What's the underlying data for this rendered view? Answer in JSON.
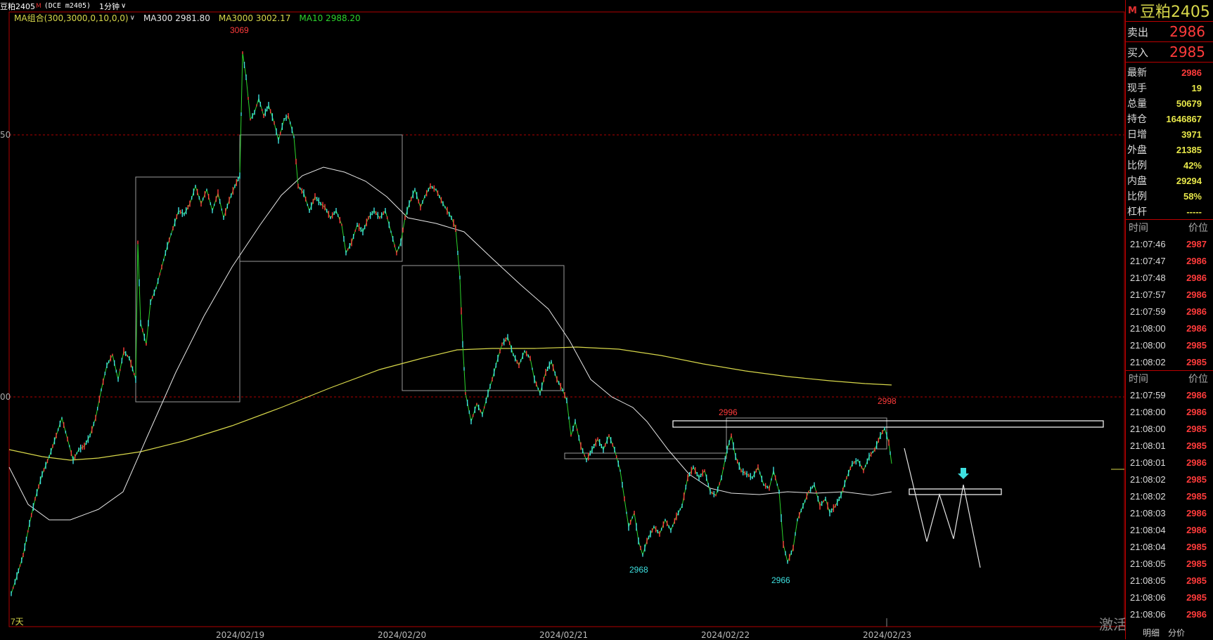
{
  "header": {
    "symbol": "豆粕2405",
    "marker": "M",
    "exchange": "(DCE m2405)",
    "interval": "1分钟"
  },
  "legend": {
    "indicator": "MA组合(300,3000,0,10,0,0)",
    "ma300": "MA300 2981.80",
    "ma3000": "MA3000 3002.17",
    "ma10": "MA10 2988.20"
  },
  "colors": {
    "up": "#ff3b3b",
    "down": "#3ee0e0",
    "ma300": "#e0e0e0",
    "ma3000": "#d8d84a",
    "ma10": "#2cd42c",
    "border": "#b00000"
  },
  "chart": {
    "period_tag": "7天",
    "left_price_marks": [
      "50",
      "00"
    ],
    "annotations": {
      "high": "3069",
      "peak1": "2996",
      "peak2": "2998",
      "low1": "2968",
      "low2": "2966"
    },
    "dates": [
      "2024/02/19",
      "2024/02/20",
      "2024/02/21",
      "2024/02/22",
      "2024/02/23"
    ]
  },
  "panel": {
    "title": "豆粕2405",
    "sell_label": "卖出",
    "sell_price": "2986",
    "buy_label": "买入",
    "buy_price": "2985",
    "stats": [
      {
        "label": "最新",
        "value": "2986"
      },
      {
        "label": "现手",
        "value": "19"
      },
      {
        "label": "总量",
        "value": "50679"
      },
      {
        "label": "持仓",
        "value": "1646867"
      },
      {
        "label": "日增",
        "value": "3971"
      },
      {
        "label": "外盘",
        "value": "21385"
      },
      {
        "label": "比例",
        "value": "42%"
      },
      {
        "label": "内盘",
        "value": "29294"
      },
      {
        "label": "比例",
        "value": "58%"
      },
      {
        "label": "杠杆",
        "value": "-----"
      }
    ],
    "time_header": "时间",
    "price_header": "价位",
    "ticks1": [
      {
        "t": "21:07:46",
        "p": "2987"
      },
      {
        "t": "21:07:47",
        "p": "2986"
      },
      {
        "t": "21:07:48",
        "p": "2986"
      },
      {
        "t": "21:07:57",
        "p": "2986"
      },
      {
        "t": "21:07:59",
        "p": "2986"
      },
      {
        "t": "21:08:00",
        "p": "2986"
      },
      {
        "t": "21:08:00",
        "p": "2985"
      },
      {
        "t": "21:08:02",
        "p": "2985"
      }
    ],
    "ticks2": [
      {
        "t": "21:07:59",
        "p": "2986"
      },
      {
        "t": "21:08:00",
        "p": "2986"
      },
      {
        "t": "21:08:00",
        "p": "2985"
      },
      {
        "t": "21:08:01",
        "p": "2985"
      },
      {
        "t": "21:08:01",
        "p": "2986"
      },
      {
        "t": "21:08:02",
        "p": "2985"
      },
      {
        "t": "21:08:02",
        "p": "2985"
      },
      {
        "t": "21:08:03",
        "p": "2986"
      },
      {
        "t": "21:08:04",
        "p": "2986"
      },
      {
        "t": "21:08:04",
        "p": "2985"
      },
      {
        "t": "21:08:05",
        "p": "2985"
      },
      {
        "t": "21:08:05",
        "p": "2985"
      },
      {
        "t": "21:08:06",
        "p": "2985"
      },
      {
        "t": "21:08:06",
        "p": "2986"
      }
    ]
  },
  "bottom": {
    "tab1": "明细",
    "tab2": "分价",
    "watermark": "激活 Windows"
  }
}
